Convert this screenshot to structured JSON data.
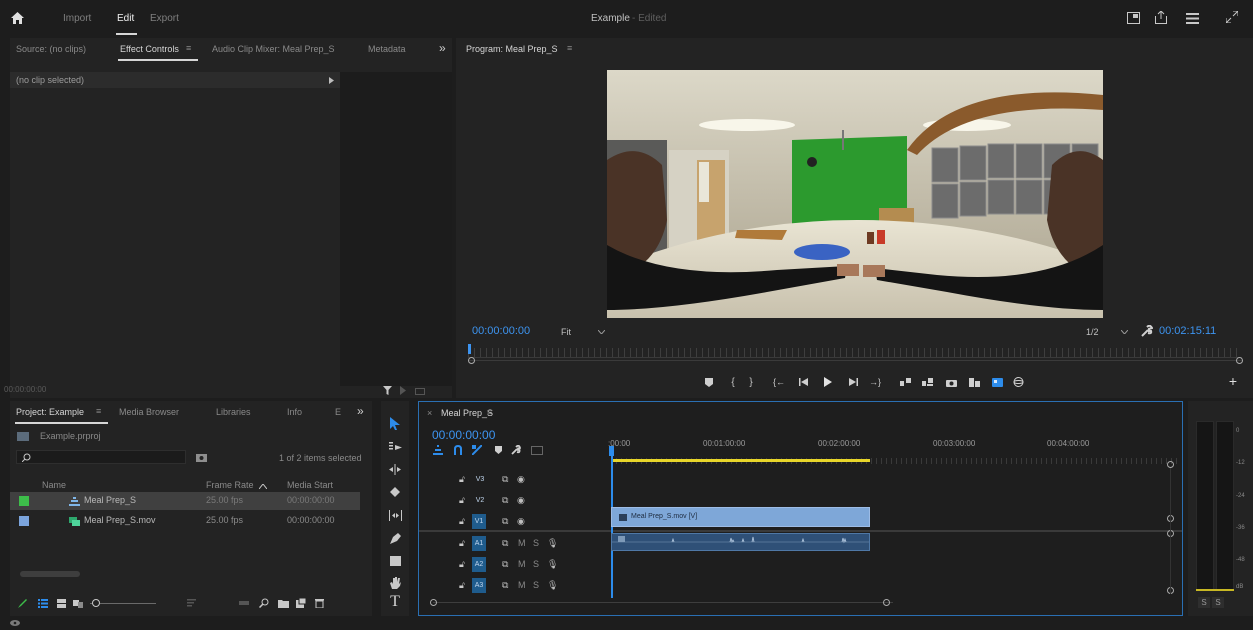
{
  "app": {
    "nav": {
      "import": "Import",
      "edit": "Edit",
      "export": "Export"
    },
    "title": "Example",
    "title_status": "- Edited"
  },
  "source_panel": {
    "tabs": [
      "Source: (no clips)",
      "Effect Controls",
      "Audio Clip Mixer: Meal Prep_S",
      "Metadata"
    ],
    "overflow": "»",
    "no_clip": "(no clip selected)",
    "timecode": "00:00:00:00"
  },
  "program": {
    "tab": "Program: Meal Prep_S",
    "timecode": "00:00:00:00",
    "fit": "Fit",
    "resolution": "1/2",
    "duration": "00:02:15:11"
  },
  "project": {
    "tabs": [
      "Project: Example",
      "Media Browser",
      "Libraries",
      "Info",
      "E"
    ],
    "overflow": "»",
    "file": "Example.prproj",
    "selected_count": "1 of 2 items selected",
    "columns": [
      "Name",
      "Frame Rate",
      "Media Start"
    ],
    "items": [
      {
        "name": "Meal Prep_S",
        "fps": "25.00 fps",
        "start": "00:00:00:00",
        "color": "#3dbd4a",
        "selected": true
      },
      {
        "name": "Meal Prep_S.mov",
        "fps": "25.00 fps",
        "start": "00:00:00:00",
        "color": "#7ba4dc",
        "selected": false
      }
    ]
  },
  "timeline": {
    "tab": "Meal Prep_S",
    "timecode": "00:00:00:00",
    "ruler": [
      ":00:00",
      "00:01:00:00",
      "00:02:00:00",
      "00:03:00:00",
      "00:04:00:00"
    ],
    "tracks": [
      {
        "name": "V3",
        "type": "video"
      },
      {
        "name": "V2",
        "type": "video"
      },
      {
        "name": "V1",
        "type": "video"
      },
      {
        "name": "A1",
        "type": "audio"
      },
      {
        "name": "A2",
        "type": "audio"
      },
      {
        "name": "A3",
        "type": "audio"
      }
    ],
    "clip_video": "Meal Prep_S.mov [V]",
    "track_flags": {
      "mute": "M",
      "solo": "S"
    }
  },
  "meter": {
    "labels": [
      "0",
      "-12",
      "-24",
      "-36",
      "-48",
      "dB"
    ],
    "solo_left": "S",
    "solo_right": "S"
  },
  "colors": {
    "accent": "#2d8ceb",
    "clip": "#7ea7d8",
    "workarea": "#e8d52a",
    "panel": "#232323"
  },
  "icons": [
    "home-icon",
    "quick-export-icon",
    "share-icon",
    "workspaces-icon",
    "fullscreen-icon"
  ]
}
